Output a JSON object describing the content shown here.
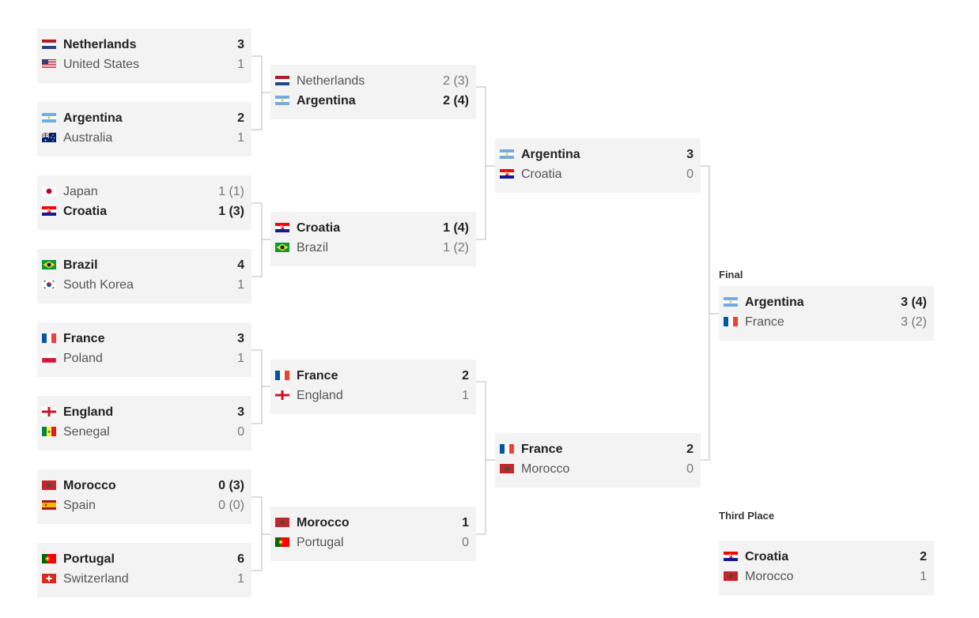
{
  "labels": {
    "final": "Final",
    "third": "Third Place"
  },
  "matches": [
    {
      "id": "r16-1",
      "t1": {
        "name": "Netherlands",
        "flag": "netherlands-flag-icon",
        "score": "3"
      },
      "t2": {
        "name": "United States",
        "flag": "united-states-flag-icon",
        "score": "1"
      },
      "winner": 1
    },
    {
      "id": "r16-2",
      "t1": {
        "name": "Argentina",
        "flag": "argentina-flag-icon",
        "score": "2"
      },
      "t2": {
        "name": "Australia",
        "flag": "australia-flag-icon",
        "score": "1"
      },
      "winner": 1
    },
    {
      "id": "r16-3",
      "t1": {
        "name": "Japan",
        "flag": "japan-flag-icon",
        "score": "1 (1)"
      },
      "t2": {
        "name": "Croatia",
        "flag": "croatia-flag-icon",
        "score": "1 (3)"
      },
      "winner": 2
    },
    {
      "id": "r16-4",
      "t1": {
        "name": "Brazil",
        "flag": "brazil-flag-icon",
        "score": "4"
      },
      "t2": {
        "name": "South Korea",
        "flag": "south-korea-flag-icon",
        "score": "1"
      },
      "winner": 1
    },
    {
      "id": "r16-5",
      "t1": {
        "name": "France",
        "flag": "france-flag-icon",
        "score": "3"
      },
      "t2": {
        "name": "Poland",
        "flag": "poland-flag-icon",
        "score": "1"
      },
      "winner": 1
    },
    {
      "id": "r16-6",
      "t1": {
        "name": "England",
        "flag": "england-flag-icon",
        "score": "3"
      },
      "t2": {
        "name": "Senegal",
        "flag": "senegal-flag-icon",
        "score": "0"
      },
      "winner": 1
    },
    {
      "id": "r16-7",
      "t1": {
        "name": "Morocco",
        "flag": "morocco-flag-icon",
        "score": "0 (3)"
      },
      "t2": {
        "name": "Spain",
        "flag": "spain-flag-icon",
        "score": "0 (0)"
      },
      "winner": 1
    },
    {
      "id": "r16-8",
      "t1": {
        "name": "Portugal",
        "flag": "portugal-flag-icon",
        "score": "6"
      },
      "t2": {
        "name": "Switzerland",
        "flag": "switzerland-flag-icon",
        "score": "1"
      },
      "winner": 1
    },
    {
      "id": "qf-1",
      "t1": {
        "name": "Netherlands",
        "flag": "netherlands-flag-icon",
        "score": "2 (3)"
      },
      "t2": {
        "name": "Argentina",
        "flag": "argentina-flag-icon",
        "score": "2 (4)"
      },
      "winner": 2
    },
    {
      "id": "qf-2",
      "t1": {
        "name": "Croatia",
        "flag": "croatia-flag-icon",
        "score": "1 (4)"
      },
      "t2": {
        "name": "Brazil",
        "flag": "brazil-flag-icon",
        "score": "1 (2)"
      },
      "winner": 1
    },
    {
      "id": "qf-3",
      "t1": {
        "name": "France",
        "flag": "france-flag-icon",
        "score": "2"
      },
      "t2": {
        "name": "England",
        "flag": "england-flag-icon",
        "score": "1"
      },
      "winner": 1
    },
    {
      "id": "qf-4",
      "t1": {
        "name": "Morocco",
        "flag": "morocco-flag-icon",
        "score": "1"
      },
      "t2": {
        "name": "Portugal",
        "flag": "portugal-flag-icon",
        "score": "0"
      },
      "winner": 1
    },
    {
      "id": "sf-1",
      "t1": {
        "name": "Argentina",
        "flag": "argentina-flag-icon",
        "score": "3"
      },
      "t2": {
        "name": "Croatia",
        "flag": "croatia-flag-icon",
        "score": "0"
      },
      "winner": 1
    },
    {
      "id": "sf-2",
      "t1": {
        "name": "France",
        "flag": "france-flag-icon",
        "score": "2"
      },
      "t2": {
        "name": "Morocco",
        "flag": "morocco-flag-icon",
        "score": "0"
      },
      "winner": 1
    },
    {
      "id": "final",
      "t1": {
        "name": "Argentina",
        "flag": "argentina-flag-icon",
        "score": "3 (4)"
      },
      "t2": {
        "name": "France",
        "flag": "france-flag-icon",
        "score": "3 (2)"
      },
      "winner": 1
    },
    {
      "id": "third",
      "t1": {
        "name": "Croatia",
        "flag": "croatia-flag-icon",
        "score": "2"
      },
      "t2": {
        "name": "Morocco",
        "flag": "morocco-flag-icon",
        "score": "1"
      },
      "winner": 1
    }
  ]
}
